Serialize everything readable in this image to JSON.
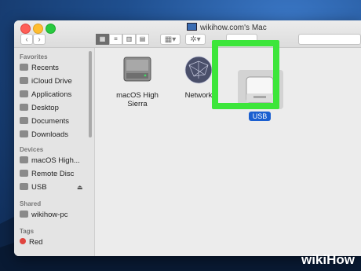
{
  "window": {
    "title": "wikihow.com's Mac"
  },
  "toolbar": {
    "back_icon": "chevron-left-icon",
    "forward_icon": "chevron-right-icon"
  },
  "sidebar": {
    "favorites_header": "Favorites",
    "favorites": [
      {
        "label": "Recents",
        "icon": "recents-icon"
      },
      {
        "label": "iCloud Drive",
        "icon": "cloud-icon"
      },
      {
        "label": "Applications",
        "icon": "applications-icon"
      },
      {
        "label": "Desktop",
        "icon": "desktop-icon"
      },
      {
        "label": "Documents",
        "icon": "documents-icon"
      },
      {
        "label": "Downloads",
        "icon": "downloads-icon"
      }
    ],
    "devices_header": "Devices",
    "devices": [
      {
        "label": "macOS High...",
        "icon": "hard-drive-icon"
      },
      {
        "label": "Remote Disc",
        "icon": "disc-icon"
      },
      {
        "label": "USB",
        "icon": "usb-drive-icon",
        "eject": "⏏"
      }
    ],
    "shared_header": "Shared",
    "shared": [
      {
        "label": "wikihow-pc",
        "icon": "computer-icon"
      }
    ],
    "tags_header": "Tags",
    "tags": [
      {
        "label": "Red",
        "color": "#e0443e"
      }
    ]
  },
  "content": {
    "items": [
      {
        "label": "macOS High Sierra",
        "icon": "hard-drive-icon"
      },
      {
        "label": "Network",
        "icon": "network-globe-icon"
      },
      {
        "label": "USB",
        "icon": "usb-drive-icon",
        "selected": true
      }
    ]
  },
  "highlight_color": "#3ce63a",
  "watermark": {
    "part1": "wiki",
    "part2": "How"
  }
}
